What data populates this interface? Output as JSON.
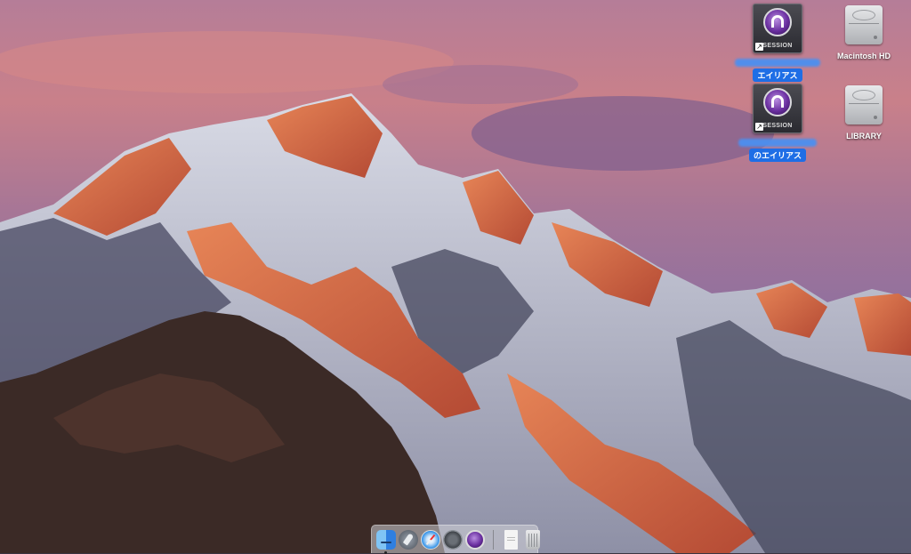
{
  "desktop": {
    "icons": [
      {
        "type": "alias",
        "label": "エイリアス",
        "tile_caption": "SESSION",
        "icon": "pro-tools-session-alias-icon"
      },
      {
        "type": "alias",
        "label": "のエイリアス",
        "tile_caption": "SESSION",
        "icon": "pro-tools-session-alias-icon"
      },
      {
        "type": "drive",
        "label": "Macintosh HD",
        "icon": "hard-drive-icon"
      },
      {
        "type": "drive",
        "label": "LIBRARY",
        "icon": "hard-drive-icon"
      }
    ]
  },
  "dock": {
    "apps": [
      {
        "icon": "finder-icon",
        "running": true
      },
      {
        "icon": "launchpad-icon",
        "running": false
      },
      {
        "icon": "safari-icon",
        "running": false
      },
      {
        "icon": "system-preferences-icon",
        "running": false
      },
      {
        "icon": "pro-tools-icon",
        "running": false
      }
    ],
    "extras": [
      {
        "icon": "document-icon"
      },
      {
        "icon": "trash-icon"
      }
    ]
  },
  "colors": {
    "selection_label": "#1e6ee6",
    "sky_top": "#c37a8e",
    "sky_bottom": "#8a6a9c",
    "mountain_lit": "#d86a45",
    "mountain_shadow": "#3e3e50"
  }
}
